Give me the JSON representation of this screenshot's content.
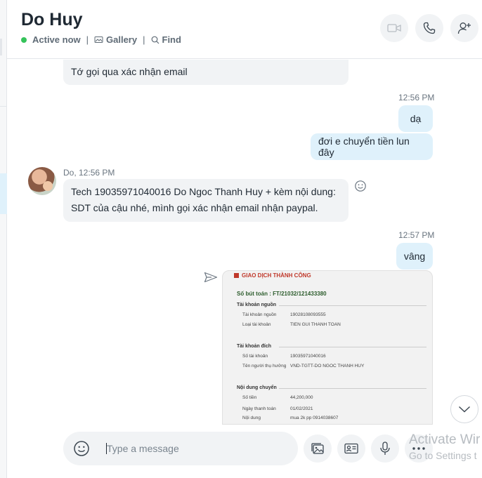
{
  "header": {
    "title": "Do Huy",
    "status": "Active now",
    "gallery": "Gallery",
    "find": "Find",
    "separator": "|"
  },
  "messages": {
    "partial_top": "Tớ gọi qua xác nhận email",
    "time_1": "12:56 PM",
    "out_1": "dạ",
    "out_2": "đơi e chuyển tiền lun đây",
    "sender_time": "Do, 12:56 PM",
    "in_line1": "Tech 19035971040016 Do Ngoc Thanh Huy + kèm nội dung:",
    "in_line2": "SDT của cậu nhé, mình gọi xác nhận email nhận paypal.",
    "time_2": "12:57 PM",
    "out_3": "vâng"
  },
  "receipt": {
    "header": "GIAO DỊCH THÀNH CÔNG",
    "reference": "Số bút toán : FT/21032/121433380",
    "section_source": "Tài khoản nguồn",
    "source_account_label": "Tài khoản nguồn",
    "source_account_value": "19028108093555",
    "source_type_label": "Loại tài khoản",
    "source_type_value": "TIEN GUI THANH TOAN",
    "section_dest": "Tài khoản đích",
    "dest_account_label": "Số tài khoản",
    "dest_account_value": "19035971040016",
    "dest_name_label": "Tên người thụ hưởng",
    "dest_name_value": "VND-TGTT-DO NGOC THANH HUY",
    "section_content": "Nội dung chuyển",
    "amount_label": "Số tiền",
    "amount_value": "44,200,000",
    "date_label": "Ngày thanh toán",
    "date_value": "01/02/2021",
    "content_label": "Nội dung",
    "content_value": "mua 2k pp 0914038607"
  },
  "composer": {
    "placeholder": "Type a message"
  },
  "watermark": {
    "line1": "Activate Wir",
    "line2": "Go to Settings t"
  },
  "colors": {
    "accent": "#35c35a",
    "outgoing_bubble": "#dff1fb",
    "incoming_bubble": "#f1f3f5"
  }
}
